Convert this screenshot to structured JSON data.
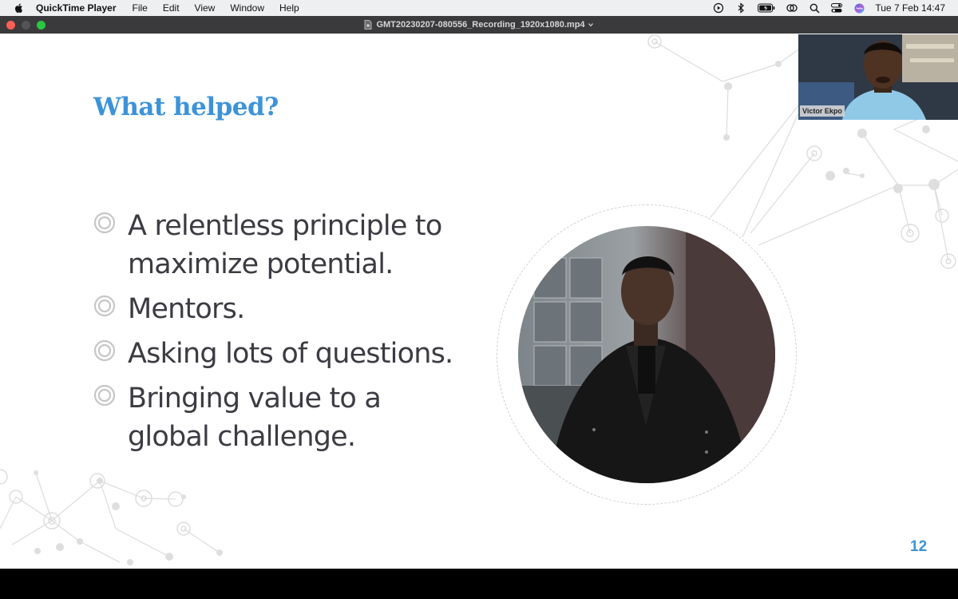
{
  "menubar": {
    "app_name": "QuickTime Player",
    "menus": [
      "File",
      "Edit",
      "View",
      "Window",
      "Help"
    ],
    "clock": "Tue 7 Feb  14:47",
    "status_icons": [
      "play-circle-icon",
      "bluetooth-icon",
      "battery-icon",
      "link-icon",
      "search-icon",
      "control-center-icon",
      "siri-icon"
    ]
  },
  "window": {
    "title": "GMT20230207-080556_Recording_1920x1080.mp4"
  },
  "slide": {
    "title": "What helped?",
    "bullets": [
      "A relentless principle to maximize potential.",
      "Mentors.",
      "Asking lots of questions.",
      "Bringing value to a global challenge."
    ],
    "page_number": "12",
    "accent_color": "#3d93d8"
  },
  "camera": {
    "participant_name": "Victor Ekpo"
  }
}
